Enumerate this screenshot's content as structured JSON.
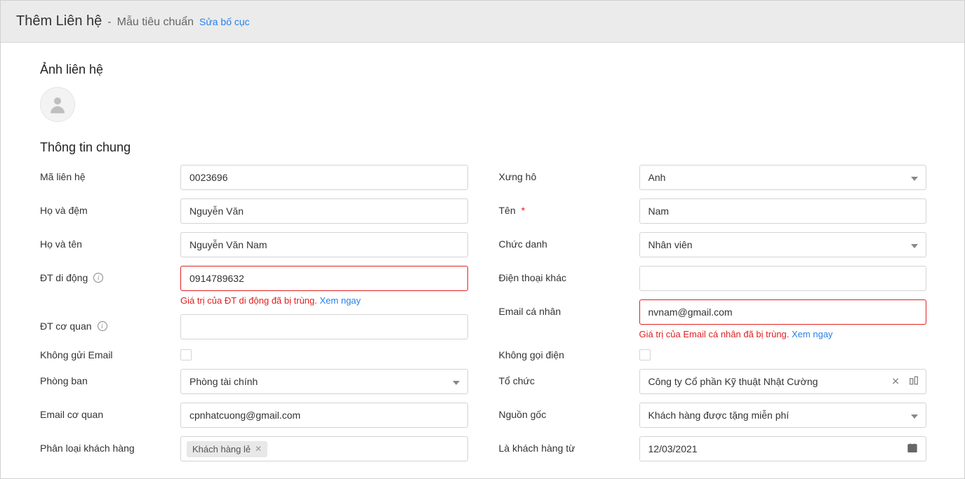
{
  "header": {
    "title": "Thêm Liên hệ",
    "subtitle": "Mẫu tiêu chuẩn",
    "edit_layout": "Sửa bố cục"
  },
  "sections": {
    "photo": "Ảnh liên hệ",
    "general": "Thông tin chung"
  },
  "labels": {
    "contact_code": "Mã liên hệ",
    "salutation": "Xưng hô",
    "last_name": "Họ và đệm",
    "first_name": "Tên",
    "full_name": "Họ và tên",
    "job_title": "Chức danh",
    "mobile": "ĐT di động",
    "other_phone": "Điện thoại khác",
    "office_phone": "ĐT cơ quan",
    "personal_email": "Email cá nhân",
    "no_email": "Không gửi Email",
    "no_call": "Không gọi điện",
    "department": "Phòng ban",
    "organization": "Tổ chức",
    "work_email": "Email cơ quan",
    "source": "Nguồn gốc",
    "customer_type": "Phân loại khách hàng",
    "customer_since": "Là khách hàng từ"
  },
  "values": {
    "contact_code": "0023696",
    "salutation": "Anh",
    "last_name": "Nguyễn Văn",
    "first_name": "Nam",
    "full_name": "Nguyễn Văn Nam",
    "job_title": "Nhân viên",
    "mobile": "0914789632",
    "other_phone": "",
    "office_phone": "",
    "personal_email": "nvnam@gmail.com",
    "department": "Phòng tài chính",
    "organization": "Công ty Cổ phần Kỹ thuật Nhật Cường",
    "work_email": "cpnhatcuong@gmail.com",
    "source": "Khách hàng được tặng miễn phí",
    "customer_type_tag": "Khách hàng lẻ",
    "customer_since": "12/03/2021"
  },
  "errors": {
    "mobile": "Giá trị của ĐT di động đã bị trùng.",
    "personal_email": "Giá trị của Email cá nhân đã bị trùng.",
    "view_now": "Xem ngay"
  }
}
